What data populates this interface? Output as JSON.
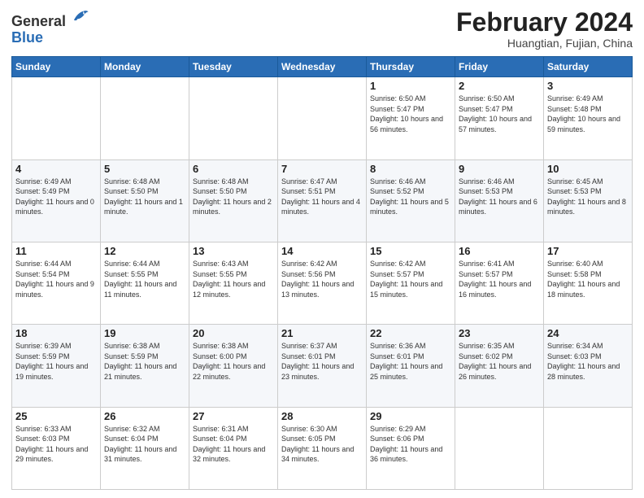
{
  "logo": {
    "general": "General",
    "blue": "Blue"
  },
  "header": {
    "month_year": "February 2024",
    "location": "Huangtian, Fujian, China"
  },
  "days_of_week": [
    "Sunday",
    "Monday",
    "Tuesday",
    "Wednesday",
    "Thursday",
    "Friday",
    "Saturday"
  ],
  "weeks": [
    [
      {
        "day": "",
        "info": ""
      },
      {
        "day": "",
        "info": ""
      },
      {
        "day": "",
        "info": ""
      },
      {
        "day": "",
        "info": ""
      },
      {
        "day": "1",
        "info": "Sunrise: 6:50 AM\nSunset: 5:47 PM\nDaylight: 10 hours and 56 minutes."
      },
      {
        "day": "2",
        "info": "Sunrise: 6:50 AM\nSunset: 5:47 PM\nDaylight: 10 hours and 57 minutes."
      },
      {
        "day": "3",
        "info": "Sunrise: 6:49 AM\nSunset: 5:48 PM\nDaylight: 10 hours and 59 minutes."
      }
    ],
    [
      {
        "day": "4",
        "info": "Sunrise: 6:49 AM\nSunset: 5:49 PM\nDaylight: 11 hours and 0 minutes."
      },
      {
        "day": "5",
        "info": "Sunrise: 6:48 AM\nSunset: 5:50 PM\nDaylight: 11 hours and 1 minute."
      },
      {
        "day": "6",
        "info": "Sunrise: 6:48 AM\nSunset: 5:50 PM\nDaylight: 11 hours and 2 minutes."
      },
      {
        "day": "7",
        "info": "Sunrise: 6:47 AM\nSunset: 5:51 PM\nDaylight: 11 hours and 4 minutes."
      },
      {
        "day": "8",
        "info": "Sunrise: 6:46 AM\nSunset: 5:52 PM\nDaylight: 11 hours and 5 minutes."
      },
      {
        "day": "9",
        "info": "Sunrise: 6:46 AM\nSunset: 5:53 PM\nDaylight: 11 hours and 6 minutes."
      },
      {
        "day": "10",
        "info": "Sunrise: 6:45 AM\nSunset: 5:53 PM\nDaylight: 11 hours and 8 minutes."
      }
    ],
    [
      {
        "day": "11",
        "info": "Sunrise: 6:44 AM\nSunset: 5:54 PM\nDaylight: 11 hours and 9 minutes."
      },
      {
        "day": "12",
        "info": "Sunrise: 6:44 AM\nSunset: 5:55 PM\nDaylight: 11 hours and 11 minutes."
      },
      {
        "day": "13",
        "info": "Sunrise: 6:43 AM\nSunset: 5:55 PM\nDaylight: 11 hours and 12 minutes."
      },
      {
        "day": "14",
        "info": "Sunrise: 6:42 AM\nSunset: 5:56 PM\nDaylight: 11 hours and 13 minutes."
      },
      {
        "day": "15",
        "info": "Sunrise: 6:42 AM\nSunset: 5:57 PM\nDaylight: 11 hours and 15 minutes."
      },
      {
        "day": "16",
        "info": "Sunrise: 6:41 AM\nSunset: 5:57 PM\nDaylight: 11 hours and 16 minutes."
      },
      {
        "day": "17",
        "info": "Sunrise: 6:40 AM\nSunset: 5:58 PM\nDaylight: 11 hours and 18 minutes."
      }
    ],
    [
      {
        "day": "18",
        "info": "Sunrise: 6:39 AM\nSunset: 5:59 PM\nDaylight: 11 hours and 19 minutes."
      },
      {
        "day": "19",
        "info": "Sunrise: 6:38 AM\nSunset: 5:59 PM\nDaylight: 11 hours and 21 minutes."
      },
      {
        "day": "20",
        "info": "Sunrise: 6:38 AM\nSunset: 6:00 PM\nDaylight: 11 hours and 22 minutes."
      },
      {
        "day": "21",
        "info": "Sunrise: 6:37 AM\nSunset: 6:01 PM\nDaylight: 11 hours and 23 minutes."
      },
      {
        "day": "22",
        "info": "Sunrise: 6:36 AM\nSunset: 6:01 PM\nDaylight: 11 hours and 25 minutes."
      },
      {
        "day": "23",
        "info": "Sunrise: 6:35 AM\nSunset: 6:02 PM\nDaylight: 11 hours and 26 minutes."
      },
      {
        "day": "24",
        "info": "Sunrise: 6:34 AM\nSunset: 6:03 PM\nDaylight: 11 hours and 28 minutes."
      }
    ],
    [
      {
        "day": "25",
        "info": "Sunrise: 6:33 AM\nSunset: 6:03 PM\nDaylight: 11 hours and 29 minutes."
      },
      {
        "day": "26",
        "info": "Sunrise: 6:32 AM\nSunset: 6:04 PM\nDaylight: 11 hours and 31 minutes."
      },
      {
        "day": "27",
        "info": "Sunrise: 6:31 AM\nSunset: 6:04 PM\nDaylight: 11 hours and 32 minutes."
      },
      {
        "day": "28",
        "info": "Sunrise: 6:30 AM\nSunset: 6:05 PM\nDaylight: 11 hours and 34 minutes."
      },
      {
        "day": "29",
        "info": "Sunrise: 6:29 AM\nSunset: 6:06 PM\nDaylight: 11 hours and 36 minutes."
      },
      {
        "day": "",
        "info": ""
      },
      {
        "day": "",
        "info": ""
      }
    ]
  ]
}
